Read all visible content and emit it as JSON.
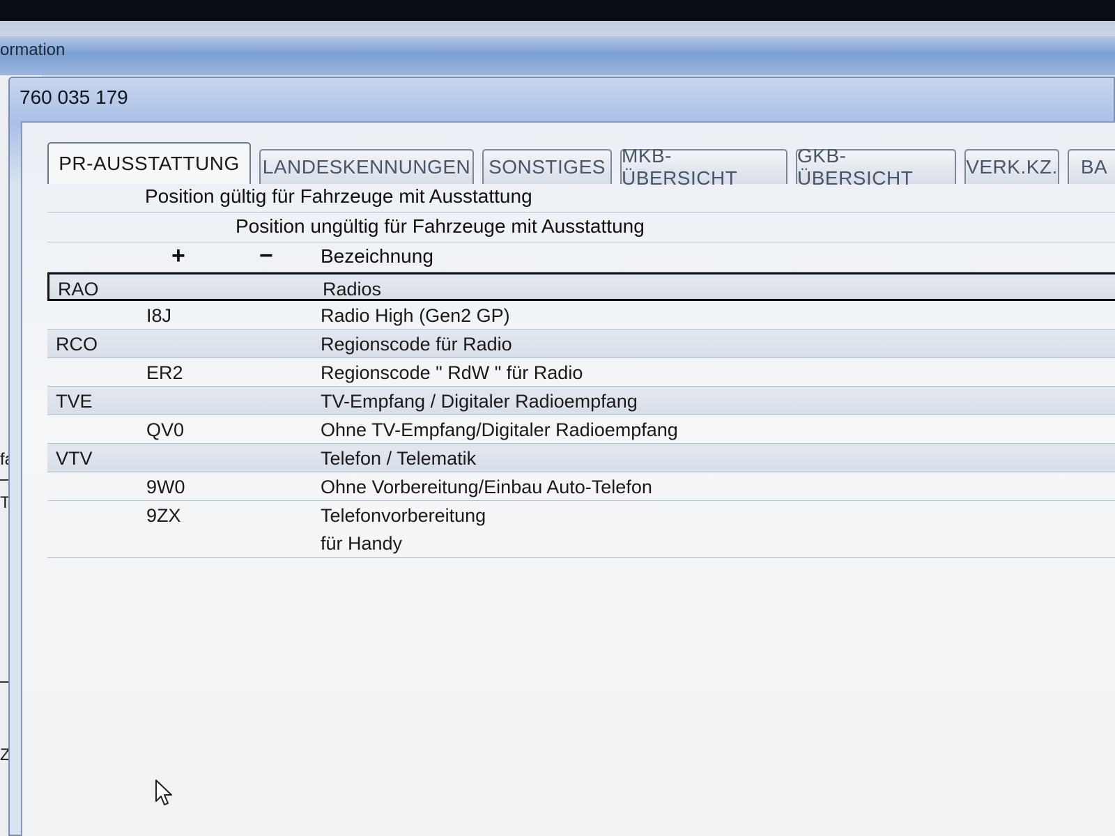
{
  "background_window": {
    "title_fragment": "ormation",
    "left_fragments": [
      "fal",
      "TE",
      "Zusa"
    ]
  },
  "dialog": {
    "title": "760 035 179"
  },
  "tabs": [
    {
      "label": "PR-AUSSTATTUNG",
      "active": true
    },
    {
      "label": "LANDESKENNUNGEN",
      "active": false
    },
    {
      "label": "SONSTIGES",
      "active": false
    },
    {
      "label": "MKB-ÜBERSICHT",
      "active": false
    },
    {
      "label": "GKB-ÜBERSICHT",
      "active": false
    },
    {
      "label": "VERK.KZ.",
      "active": false
    },
    {
      "label": "BA",
      "active": false
    }
  ],
  "table": {
    "header_valid": "Position gültig für Fahrzeuge mit Ausstattung",
    "header_invalid": "Position ungültig für Fahrzeuge mit Ausstattung",
    "col_plus": "+",
    "col_minus": "−",
    "col_desc": "Bezeichnung",
    "rows": [
      {
        "code": "RAO",
        "plus": "",
        "desc": "Radios",
        "group": true,
        "selected": true
      },
      {
        "code": "",
        "plus": "I8J",
        "desc": "Radio High (Gen2 GP)"
      },
      {
        "code": "RCO",
        "plus": "",
        "desc": "Regionscode für Radio",
        "group": true
      },
      {
        "code": "",
        "plus": "ER2",
        "desc": "Regionscode \" RdW \" für Radio"
      },
      {
        "code": "TVE",
        "plus": "",
        "desc": "TV-Empfang / Digitaler Radioempfang",
        "group": true
      },
      {
        "code": "",
        "plus": "QV0",
        "desc": "Ohne TV-Empfang/Digitaler Radioempfang"
      },
      {
        "code": "VTV",
        "plus": "",
        "desc": "Telefon / Telematik",
        "group": true
      },
      {
        "code": "",
        "plus": "9W0",
        "desc": "Ohne Vorbereitung/Einbau Auto-Telefon"
      },
      {
        "code": "",
        "plus": "9ZX",
        "desc": "Telefonvorbereitung",
        "desc2": "für Handy"
      }
    ]
  }
}
